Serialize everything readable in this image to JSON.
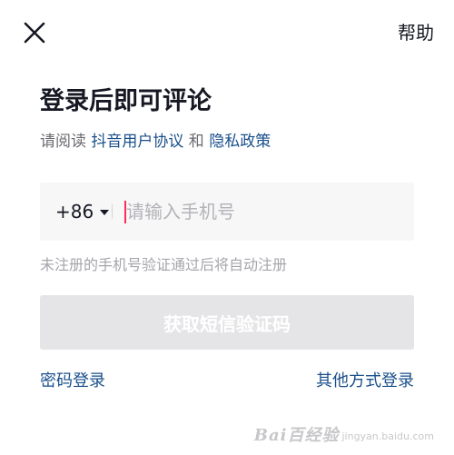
{
  "header": {
    "close_icon": "close-icon",
    "help_label": "帮助"
  },
  "main": {
    "title": "登录后即可评论",
    "agreement": {
      "prefix": "请阅读 ",
      "user_agreement": "抖音用户协议",
      "conjunction": " 和 ",
      "privacy_policy": "隐私政策"
    },
    "phone": {
      "country_code": "+86",
      "placeholder": "请输入手机号",
      "value": ""
    },
    "hint": "未注册的手机号验证通过后将自动注册",
    "sms_button_label": "获取短信验证码",
    "password_login_label": "密码登录",
    "other_login_label": "其他方式登录"
  },
  "watermark": {
    "text": "Bai百经验",
    "sub": "jingyan.baidu.com"
  },
  "colors": {
    "link": "#1a4f8a",
    "accent_cursor": "#fe2c55",
    "disabled_button": "#e5e5e7",
    "input_background": "#f7f7f8"
  }
}
